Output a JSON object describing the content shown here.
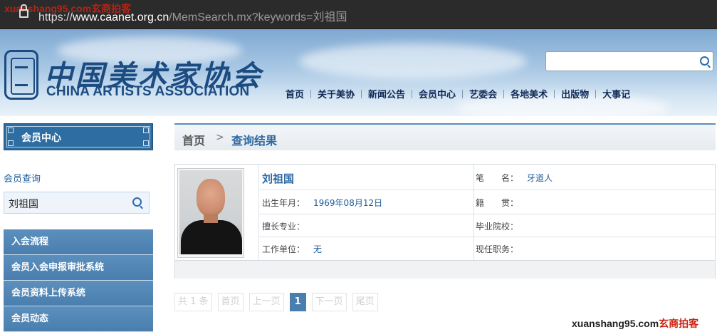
{
  "browser": {
    "url_scheme": "https://",
    "url_host": "www.caanet.org.cn",
    "url_path": "/MemSearch.mx?keywords=刘祖国",
    "watermark_top": "xuanshang95.com玄商拍客"
  },
  "header": {
    "logo_cn": "中国美术家协会",
    "logo_en": "CHINA ARTISTS ASSOCIATION",
    "search_value": "",
    "nav": [
      "首页",
      "关于美协",
      "新闻公告",
      "会员中心",
      "艺委会",
      "各地美术",
      "出版物",
      "大事记"
    ]
  },
  "sidebar": {
    "heading": "会员中心",
    "search_label": "会员查询",
    "search_value": "刘祖国",
    "menu": [
      "入会流程",
      "会员入会申报审批系统",
      "会员资料上传系统",
      "会员动态"
    ]
  },
  "breadcrumb": {
    "home": "首页",
    "separator": ">",
    "current": "查询结果"
  },
  "result": {
    "name": "刘祖国",
    "pen_name_label": "笔　　名：",
    "pen_name_value": "牙道人",
    "birth_label": "出生年月：",
    "birth_value": "1969年08月12日",
    "native_label": "籍　　贯：",
    "native_value": "",
    "specialty_label": "擅长专业：",
    "specialty_value": "",
    "school_label": "毕业院校：",
    "school_value": "",
    "work_label": "工作单位：",
    "work_value": "无",
    "position_label": "现任职务：",
    "position_value": ""
  },
  "pager": {
    "total": "共 1 条",
    "first": "首页",
    "prev": "上一页",
    "current": "1",
    "next": "下一页",
    "last": "尾页"
  },
  "watermark_bottom": {
    "domain": "xuanshang95.com",
    "brand": "玄商拍客"
  }
}
